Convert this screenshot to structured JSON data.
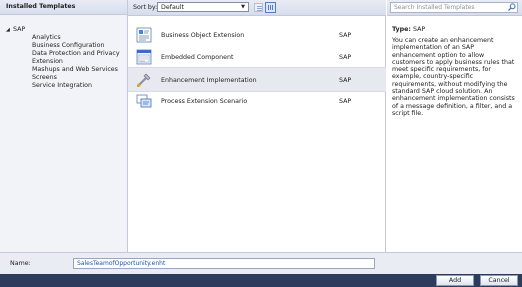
{
  "left_panel": {
    "header": "Installed Templates",
    "expander": "◢",
    "root": "SAP",
    "items": [
      "Analytics",
      "Business Configuration",
      "Data Protection and Privacy",
      "Extension",
      "Mashups and Web Services",
      "Screens",
      "Service Integration"
    ]
  },
  "toolbar": {
    "sort_label": "Sort by:",
    "sort_value": "Default",
    "sort_arrow": "▼"
  },
  "templates": [
    {
      "name": "Business Object Extension",
      "type": "SAP",
      "icon": "business-object-extension-icon",
      "selected": false
    },
    {
      "name": "Embedded Component",
      "type": "SAP",
      "icon": "embedded-component-icon",
      "selected": false
    },
    {
      "name": "Enhancement Implementation",
      "type": "SAP",
      "icon": "enhancement-implementation-icon",
      "selected": true
    },
    {
      "name": "Process Extension Scenario",
      "type": "SAP",
      "icon": "process-extension-scenario-icon",
      "selected": false
    }
  ],
  "right_panel": {
    "search_placeholder": "Search Installed Templates",
    "type_label": "Type:",
    "type_value": "SAP",
    "description": "You can create an enhancement implementation of an SAP enhancement option to allow customers to apply business rules that meet specific requirements, for example, country-specific requirements, without modifying the standard SAP cloud solution. An enhancement implementation consists of a message definition, a filter, and a script file."
  },
  "bottom": {
    "name_label": "Name:",
    "name_value": "SalesTeamofOpportunity.enht",
    "add_label": "Add",
    "cancel_label": "Cancel"
  },
  "colors": {
    "accent": "#1c56b8",
    "button_bar": "#2d3c5c",
    "selection": "#e6e9ef"
  }
}
